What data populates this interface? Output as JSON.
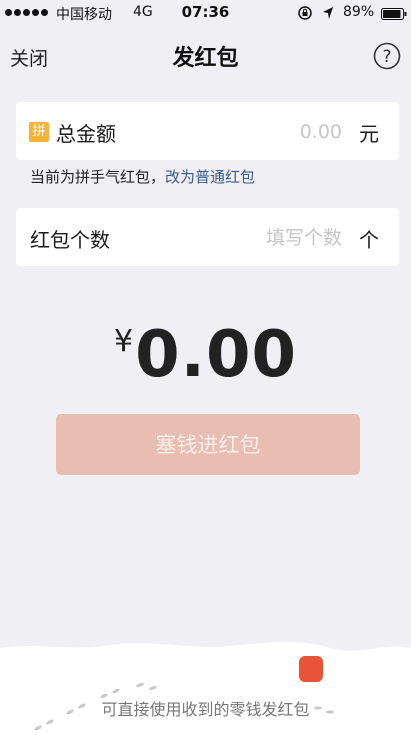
{
  "status_bar": {
    "carrier": "中国移动",
    "network": "4G",
    "time": "07:36",
    "battery": "89%"
  },
  "nav": {
    "close_label": "关闭",
    "title": "发红包",
    "help_icon": "question-circle-icon"
  },
  "amount_field": {
    "badge": "拼",
    "label": "总金额",
    "placeholder": "0.00",
    "unit": "元"
  },
  "hint": {
    "text": "当前为拼手气红包，",
    "link": "改为普通红包"
  },
  "count_field": {
    "label": "红包个数",
    "placeholder": "填写个数",
    "unit": "个"
  },
  "summary": {
    "currency": "¥",
    "amount": "0.00"
  },
  "submit_label": "塞钱进红包",
  "footer_text": "可直接使用收到的零钱发红包",
  "colors": {
    "background": "#efeff4",
    "button": "#e8bdb2",
    "link": "#3a5a8c",
    "badge": "#f4b43a",
    "red_packet": "#e8533a"
  }
}
